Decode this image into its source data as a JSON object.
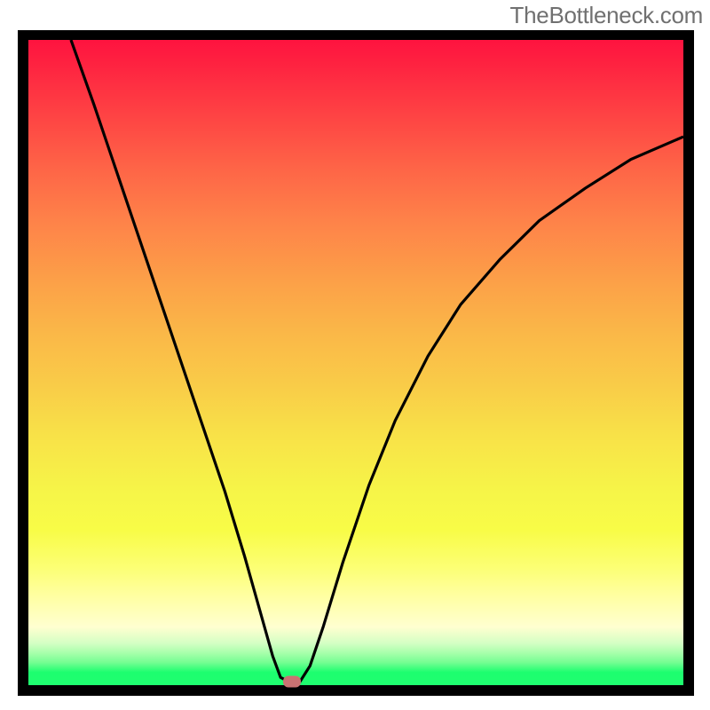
{
  "watermark": "TheBottleneck.com",
  "chart_data": {
    "type": "line",
    "title": "",
    "xlabel": "",
    "ylabel": "",
    "xlim": [
      0,
      100
    ],
    "ylim": [
      0,
      100
    ],
    "grid": false,
    "legend": false,
    "marker": {
      "x": 40.2,
      "y": 0.5
    },
    "series": [
      {
        "name": "curve",
        "points": [
          {
            "x": 6.5,
            "y": 100
          },
          {
            "x": 10,
            "y": 90
          },
          {
            "x": 14,
            "y": 78
          },
          {
            "x": 18,
            "y": 66
          },
          {
            "x": 22,
            "y": 54
          },
          {
            "x": 26,
            "y": 42
          },
          {
            "x": 30,
            "y": 30
          },
          {
            "x": 33,
            "y": 20
          },
          {
            "x": 35.5,
            "y": 11
          },
          {
            "x": 37.3,
            "y": 4.5
          },
          {
            "x": 38.5,
            "y": 1.2
          },
          {
            "x": 40,
            "y": 0.4
          },
          {
            "x": 41.5,
            "y": 0.6
          },
          {
            "x": 43,
            "y": 3
          },
          {
            "x": 45,
            "y": 9
          },
          {
            "x": 48,
            "y": 19
          },
          {
            "x": 52,
            "y": 31
          },
          {
            "x": 56,
            "y": 41
          },
          {
            "x": 61,
            "y": 51
          },
          {
            "x": 66,
            "y": 59
          },
          {
            "x": 72,
            "y": 66
          },
          {
            "x": 78,
            "y": 72
          },
          {
            "x": 85,
            "y": 77
          },
          {
            "x": 92,
            "y": 81.5
          },
          {
            "x": 100,
            "y": 85
          }
        ]
      }
    ],
    "gradient_colors": {
      "top": "#fe133f",
      "mid_orange": "#fca248",
      "mid_yellow": "#f8e148",
      "pale": "#ffffd0",
      "bottom": "#1efe6f"
    }
  }
}
